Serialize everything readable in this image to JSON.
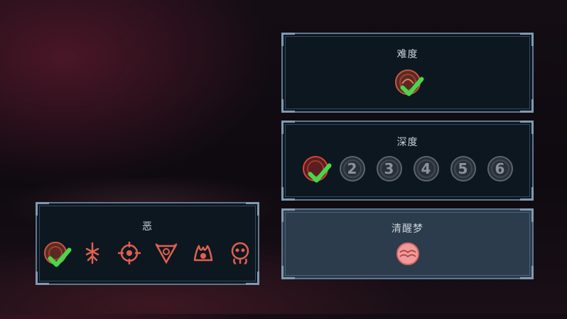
{
  "panels": {
    "difficulty": {
      "title": "难度"
    },
    "depth": {
      "title": "深度",
      "levels": [
        "2",
        "3",
        "4",
        "5",
        "6"
      ]
    },
    "lucid_dream": {
      "title": "清醒梦"
    },
    "evil": {
      "title": "恶"
    }
  },
  "colors": {
    "accent_red": "#e0604e",
    "check_green": "#46d84a",
    "locked_grey": "#5a6470"
  }
}
